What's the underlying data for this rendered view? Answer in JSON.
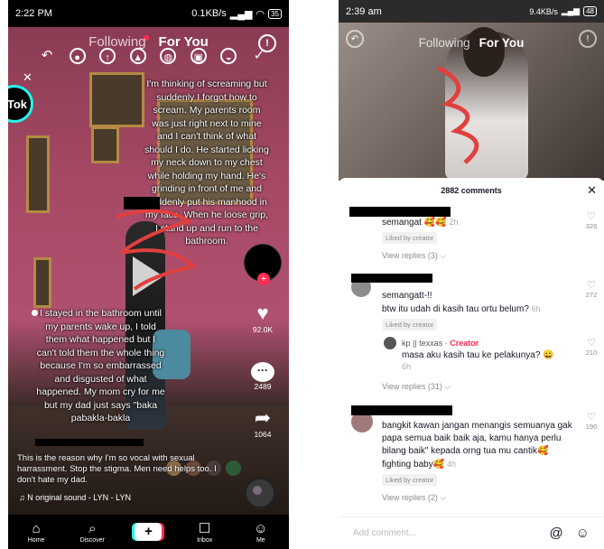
{
  "left_phone": {
    "status": {
      "time": "2:22 PM",
      "network": "0.1KB/s",
      "battery": "35"
    },
    "nav": {
      "following": "Following",
      "for_you": "For You"
    },
    "badge_text": "Tok",
    "story_top": "I'm thinking of screaming but suddenly I forgot how to scream. My parents room was just right next to mine and I can't think of what should I do. He started licking my neck down to my chest while holding my hand. He's grinding in front of me and suddenly put his manhood in my face. When he loose grip, I stand up and run to the bathroom.",
    "story_bottom": "I stayed in the bathroom until my parents wake up, I told them what happened but I can't told them the whole thing because I'm so embarrassed and disgusted of what happened. My mom cry for me but my dad just says \"baka pabakla-bakla",
    "actions": {
      "likes": "92.0K",
      "comments": "2489",
      "shares": "1064"
    },
    "caption": "This is the reason why I'm so vocal with sexual harrassment. Stop the stigma. Men need helps too. I don't hate my dad.",
    "sound": "N    original sound - LYN - LYN",
    "bottom_nav": [
      "Home",
      "Discover",
      "",
      "Inbox",
      "Me"
    ],
    "colors": {
      "accent": "#fe2c55",
      "cyan": "#25f4ee"
    }
  },
  "right_phone": {
    "status": {
      "time": "2:39 am",
      "network": "9.4KB/s",
      "battery": "48"
    },
    "nav": {
      "following": "Following",
      "for_you": "For You"
    },
    "sheet_title": "2882 comments",
    "comments": [
      {
        "text": "semangat 🥰🥰",
        "time": "2h",
        "liked": "Liked by creator",
        "replies": "View replies (3)",
        "likes": "326"
      },
      {
        "text": "semangatt-!!",
        "text2": "btw itu udah di kasih tau ortu belum?",
        "time": "6h",
        "liked": "Liked by creator",
        "likes": "272"
      },
      {
        "reply_author": "kp || texxas",
        "creator_tag": "Creator",
        "text": "masa aku kasih tau ke pelakunya? 😀",
        "time": "6h",
        "likes": "210",
        "replies": "View replies (31)"
      },
      {
        "text": "bangkit kawan jangan menangis semuanya gak papa semua baik baik aja, kamu hanya perlu bilang baik\" kepada orng tua mu cantik🥰 fighting baby🥰",
        "time": "4h",
        "liked": "Liked by creator",
        "replies": "View replies (2)",
        "likes": "190"
      }
    ],
    "add_comment_placeholder": "Add comment...",
    "colors": {
      "accent": "#fe2c55"
    }
  }
}
